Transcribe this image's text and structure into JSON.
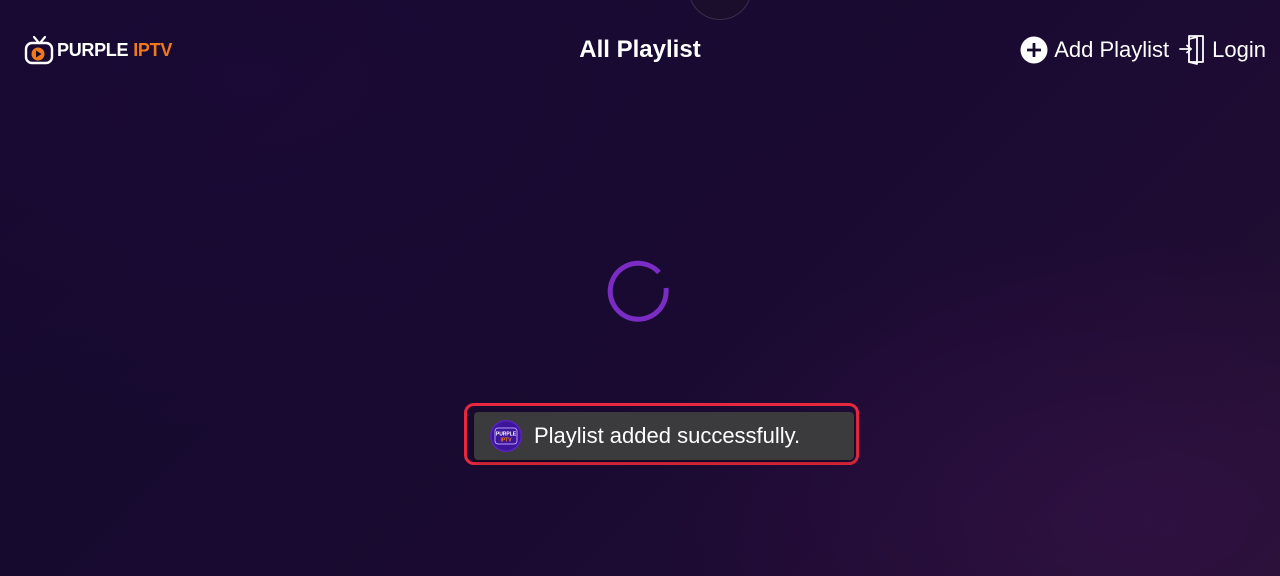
{
  "app": {
    "logo_word_1": "PURPLE",
    "logo_word_2": "IPTV",
    "logo_accent_color": "#f07a1a"
  },
  "header": {
    "title": "All Playlist"
  },
  "actions": {
    "add_playlist_label": "Add Playlist",
    "add_playlist_icon": "plus-circle-icon",
    "login_label": "Login",
    "login_icon": "door-enter-icon"
  },
  "loading": {
    "spinner_color": "#7a2cc4"
  },
  "toast": {
    "message": "Playlist added successfully.",
    "app_icon_text_1": "PURPLE",
    "app_icon_text_2": "IPTV",
    "highlight_color": "#e8283e"
  }
}
